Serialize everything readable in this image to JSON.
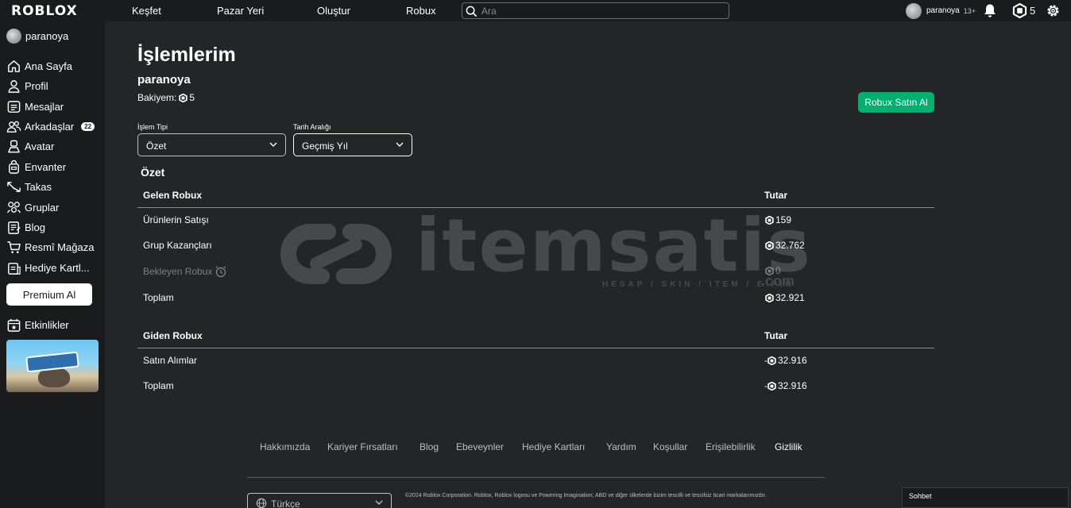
{
  "header": {
    "logo": "ROBLOX",
    "nav": [
      "Keşfet",
      "Pazar Yeri",
      "Oluştur",
      "Robux"
    ],
    "search_placeholder": "Ara",
    "username": "paranoya",
    "age_label": "13+",
    "robux": "5"
  },
  "sidebar": {
    "username": "paranoya",
    "items": [
      {
        "label": "Ana Sayfa",
        "icon": "home-icon"
      },
      {
        "label": "Profil",
        "icon": "profile-icon"
      },
      {
        "label": "Mesajlar",
        "icon": "messages-icon"
      },
      {
        "label": "Arkadaşlar",
        "icon": "friends-icon",
        "badge": "22"
      },
      {
        "label": "Avatar",
        "icon": "avatar-icon"
      },
      {
        "label": "Envanter",
        "icon": "inventory-icon"
      },
      {
        "label": "Takas",
        "icon": "trade-icon"
      },
      {
        "label": "Gruplar",
        "icon": "groups-icon"
      },
      {
        "label": "Blog",
        "icon": "blog-icon"
      },
      {
        "label": "Resmî Mağaza",
        "icon": "store-icon"
      },
      {
        "label": "Hediye Kartl...",
        "icon": "gift-card-icon"
      }
    ],
    "premium_button": "Premium Al",
    "events_label": "Etkinlikler"
  },
  "main": {
    "title": "İşlemlerim",
    "username": "paranoya",
    "balance_label": "Bakiyem:",
    "balance_value": "5",
    "buy_button": "Robux Satın Al",
    "filters": {
      "type_label": "İşlem Tipi",
      "type_value": "Özet",
      "range_label": "Tarih Aralığı",
      "range_value": "Geçmiş Yıl"
    },
    "summary_title": "Özet",
    "incoming": {
      "header": "Gelen Robux",
      "amount_header": "Tutar",
      "rows": [
        {
          "label": "Ürünlerin Satışı",
          "value": "159"
        },
        {
          "label": "Grup Kazançları",
          "value": "32.762"
        },
        {
          "label": "Bekleyen Robux",
          "value": "0"
        },
        {
          "label": "Toplam",
          "value": "32.921"
        }
      ]
    },
    "outgoing": {
      "header": "Giden Robux",
      "amount_header": "Tutar",
      "rows": [
        {
          "label": "Satın Alımlar",
          "value": "32.916",
          "sign": "-"
        },
        {
          "label": "Toplam",
          "value": "32.916",
          "sign": "-"
        }
      ]
    }
  },
  "watermark": {
    "brand": "itemsatis",
    "tagline": "HESAP / SKIN / ITEM / E-PIN",
    "suffix": ".com"
  },
  "footer": {
    "links": [
      "Hakkımızda",
      "Kariyer Fırsatları",
      "Blog",
      "Ebeveynler",
      "Hediye Kartları",
      "Yardım",
      "Koşullar",
      "Erişilebilirlik",
      "Gizlilik"
    ],
    "language": "Türkçe",
    "copyright": "©2024 Roblox Corporation. Roblox, Roblox logosu ve Powering Imagination; ABD ve diğer ülkelerde bizim tescilli ve tescilsiz ticari markalarımızdır."
  },
  "chat": {
    "label": "Sohbet"
  },
  "colors": {
    "accent_green": "#00b06f",
    "background": "#232527",
    "sidebar": "#191b1d"
  }
}
